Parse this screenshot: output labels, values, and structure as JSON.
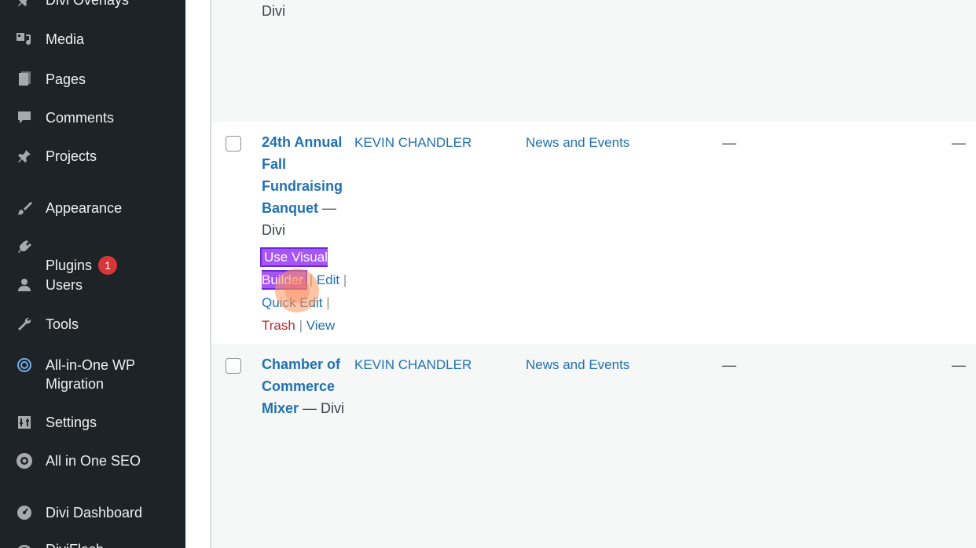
{
  "sidebar": {
    "items": [
      {
        "label": "Divi Overlays",
        "icon": "pin-icon"
      },
      {
        "label": "Media",
        "icon": "media-icon"
      },
      {
        "label": "Pages",
        "icon": "pages-icon"
      },
      {
        "label": "Comments",
        "icon": "comments-icon"
      },
      {
        "label": "Projects",
        "icon": "pin-icon"
      },
      {
        "label": "Appearance",
        "icon": "brush-icon"
      },
      {
        "label": "Plugins",
        "icon": "plugin-icon",
        "badge": "1"
      },
      {
        "label": "Users",
        "icon": "users-icon"
      },
      {
        "label": "Tools",
        "icon": "wrench-icon"
      },
      {
        "label": "All-in-One WP\nMigration",
        "icon": "migration-icon"
      },
      {
        "label": "Settings",
        "icon": "settings-icon"
      },
      {
        "label": "All in One SEO",
        "icon": "seo-gear-icon"
      },
      {
        "label": "Divi Dashboard",
        "icon": "dashboard-icon"
      },
      {
        "label": "DiviFlash",
        "icon": "flash-icon"
      }
    ]
  },
  "posts": [
    {
      "title_tail": "Divi"
    },
    {
      "title": "24th Annual Fall Fundraising Banquet",
      "state": "— Divi",
      "author": "KEVIN CHANDLER",
      "category": "News and Events",
      "tags": "—",
      "comments": "—",
      "actions": {
        "visual_builder": "Use Visual Builder",
        "edit": "Edit",
        "quick_edit": "Quick Edit",
        "trash": "Trash",
        "view": "View",
        "sep": "|"
      }
    },
    {
      "title": "Chamber of Commerce Mixer",
      "state": "— Divi",
      "author": "KEVIN CHANDLER",
      "category": "News and Events",
      "tags": "—",
      "comments": "—"
    }
  ],
  "colors": {
    "sidebar_bg": "#1d2327",
    "link": "#2271b1",
    "badge": "#d63638",
    "visual_builder": "#a855f7"
  }
}
